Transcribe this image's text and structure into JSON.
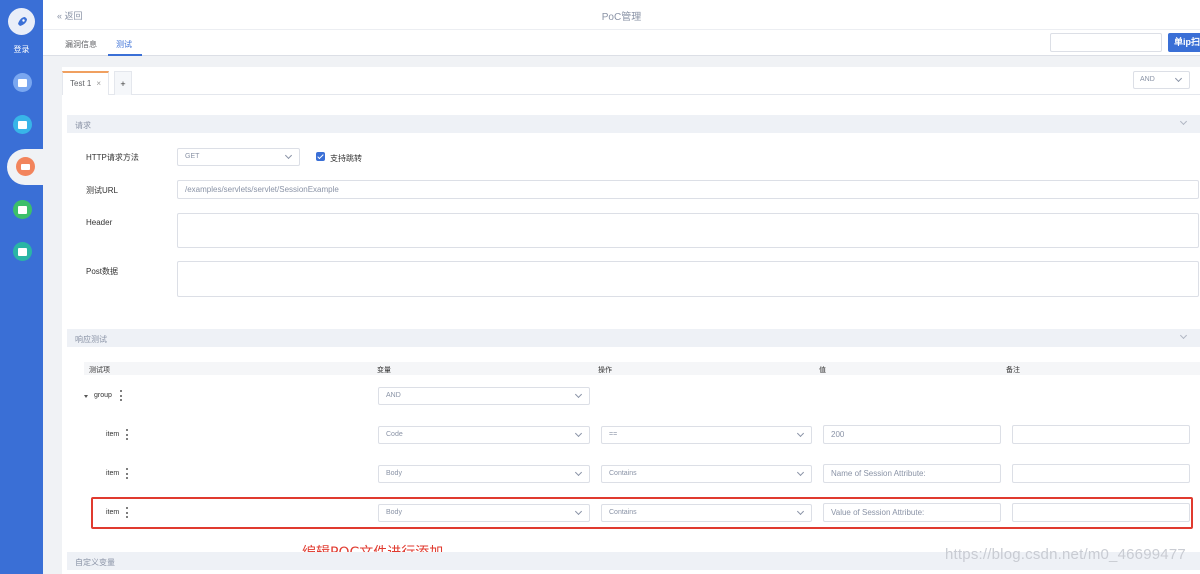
{
  "sidebar": {
    "logo_label": "登录",
    "items": [
      {
        "icon": "server-icon",
        "color": "#7aa7f0"
      },
      {
        "icon": "list-icon",
        "color": "#38b5e8"
      },
      {
        "icon": "monitor-icon",
        "color": "#f2845c",
        "active": true
      },
      {
        "icon": "chart-icon",
        "color": "#3cbf6a"
      },
      {
        "icon": "shield-icon",
        "color": "#2ab5a5"
      }
    ]
  },
  "header": {
    "back_label": "« 返回",
    "title": "PoC管理"
  },
  "tabs": {
    "items": [
      "漏洞信息",
      "测试"
    ],
    "active": "测试",
    "scan_button": "单ip扫"
  },
  "test_tabs": {
    "tab_label": "Test 1",
    "close_glyph": "×",
    "add_label": "+",
    "logic_select": "AND"
  },
  "request": {
    "section_title": "请求",
    "method_label": "HTTP请求方法",
    "method_value": "GET",
    "follow_redirect_label": "支持跳转",
    "follow_redirect_checked": true,
    "url_label": "测试URL",
    "url_value": "/examples/servlets/servlet/SessionExample",
    "header_label": "Header",
    "header_value": "",
    "post_label": "Post数据",
    "post_value": ""
  },
  "response": {
    "section_title": "响应测试",
    "columns": [
      "测试项",
      "变量",
      "操作",
      "值",
      "备注"
    ],
    "group": {
      "label": "group",
      "operator": "AND"
    },
    "items": [
      {
        "label": "item",
        "variable": "Code",
        "operation": "==",
        "value": "200",
        "note": ""
      },
      {
        "label": "item",
        "variable": "Body",
        "operation": "Contains",
        "value": "Name of Session Attribute:",
        "note": ""
      },
      {
        "label": "item",
        "variable": "Body",
        "operation": "Contains",
        "value": "Value of Session Attribute:",
        "note": ""
      }
    ]
  },
  "custom_vars": {
    "section_title": "自定义变量"
  },
  "annotation": "编辑POC文件进行添加",
  "watermark": "https://blog.csdn.net/m0_46699477",
  "colors": {
    "accent": "#3a6fd6",
    "highlight_box": "#e03a2f",
    "tab_top_border": "#f0a060"
  }
}
